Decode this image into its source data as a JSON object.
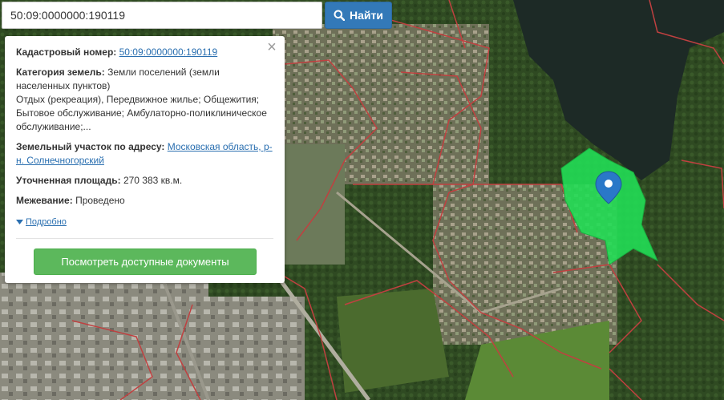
{
  "search": {
    "query": "50:09:0000000:190119",
    "button_label": "Найти"
  },
  "info": {
    "cadastral_label": "Кадастровый номер:",
    "cadastral_value": "50:09:0000000:190119",
    "category_label": "Категория земель:",
    "category_value": "Земли поселений (земли населенных пунктов)",
    "uses_text": "Отдых (рекреация), Передвижное жилье; Общежития; Бытовое обслуживание; Амбулаторно-поликлиническое обслуживание;...",
    "address_label": "Земельный участок по адресу:",
    "address_value": "Московская область, р-н. Солнечногорский",
    "area_label": "Уточненная площадь:",
    "area_value": "270 383 кв.м.",
    "survey_label": "Межевание:",
    "survey_value": "Проведено",
    "more_label": "Подробно",
    "docs_button_label": "Посмотреть доступные документы"
  },
  "colors": {
    "primary_button": "#3379b8",
    "success_button": "#5cb85c",
    "link": "#2a6fb0",
    "parcel_fill": "#22dd55",
    "parcel_border": "#c04040",
    "marker": "#2a78c8"
  }
}
